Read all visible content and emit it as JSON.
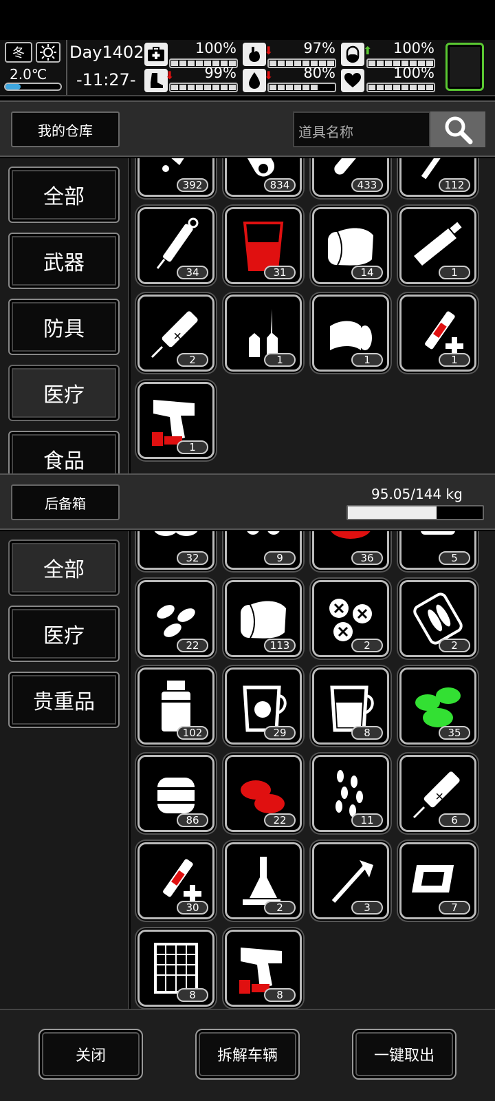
{
  "status": {
    "season": "冬",
    "temperature": "2.0℃",
    "day": "Day1402",
    "time": "-11:27-",
    "health": "100%",
    "hunger": "97%",
    "energy": "100%",
    "stamina": "99%",
    "thirst": "80%",
    "mood": "100%"
  },
  "warehouse": {
    "title": "我的仓库",
    "search_placeholder": "道具名称",
    "categories": [
      "全部",
      "武器",
      "防具",
      "医疗",
      "食品"
    ],
    "selected": "医疗",
    "items": [
      {
        "icon": "ointment-icon",
        "count": "392"
      },
      {
        "icon": "roll-icon",
        "count": "834"
      },
      {
        "icon": "tube-icon",
        "count": "433"
      },
      {
        "icon": "stick-icon",
        "count": "112"
      },
      {
        "icon": "syringe-icon",
        "count": "34"
      },
      {
        "icon": "red-cup-icon",
        "count": "31"
      },
      {
        "icon": "bandage-roll-icon",
        "count": "14"
      },
      {
        "icon": "cream-tube-icon",
        "count": "1"
      },
      {
        "icon": "injector-icon",
        "count": "2"
      },
      {
        "icon": "ampoule-icon",
        "count": "1"
      },
      {
        "icon": "bandage-icon",
        "count": "1"
      },
      {
        "icon": "medical-syringe-icon",
        "count": "1"
      },
      {
        "icon": "flare-gun-icon",
        "count": "1"
      }
    ]
  },
  "trunk": {
    "title": "后备箱",
    "weight": "95.05/144 kg",
    "weight_fraction": 0.66,
    "categories": [
      "全部",
      "医疗",
      "贵重品"
    ],
    "selected": "全部",
    "items": [
      {
        "icon": "herb-icon",
        "count": "32"
      },
      {
        "icon": "mushroom-icon",
        "count": "9"
      },
      {
        "icon": "red-herb-icon",
        "count": "36"
      },
      {
        "icon": "pill-pack-icon",
        "count": "5"
      },
      {
        "icon": "pills-icon",
        "count": "22"
      },
      {
        "icon": "bandage-roll-icon",
        "count": "113"
      },
      {
        "icon": "tablets-icon",
        "count": "2"
      },
      {
        "icon": "blister-icon",
        "count": "2"
      },
      {
        "icon": "bottle-icon",
        "count": "102"
      },
      {
        "icon": "beaker-herb-icon",
        "count": "29"
      },
      {
        "icon": "beaker-dots-icon",
        "count": "8"
      },
      {
        "icon": "green-herb-icon",
        "count": "35"
      },
      {
        "icon": "jar-icon",
        "count": "86"
      },
      {
        "icon": "red-leaf-icon",
        "count": "22"
      },
      {
        "icon": "seeds-icon",
        "count": "11"
      },
      {
        "icon": "injector-icon",
        "count": "6"
      },
      {
        "icon": "medical-syringe-icon",
        "count": "30"
      },
      {
        "icon": "lab-flask-icon",
        "count": "2"
      },
      {
        "icon": "drill-icon",
        "count": "3"
      },
      {
        "icon": "chip-icon",
        "count": "7"
      },
      {
        "icon": "grid-panel-icon",
        "count": "8"
      },
      {
        "icon": "flare-gun-icon",
        "count": "8"
      }
    ]
  },
  "buttons": {
    "close": "关闭",
    "dismantle": "拆解车辆",
    "take_all": "一键取出"
  },
  "colors": {
    "accent_green": "#5ac832",
    "danger_red": "#e01010",
    "herb_green": "#33e033"
  }
}
